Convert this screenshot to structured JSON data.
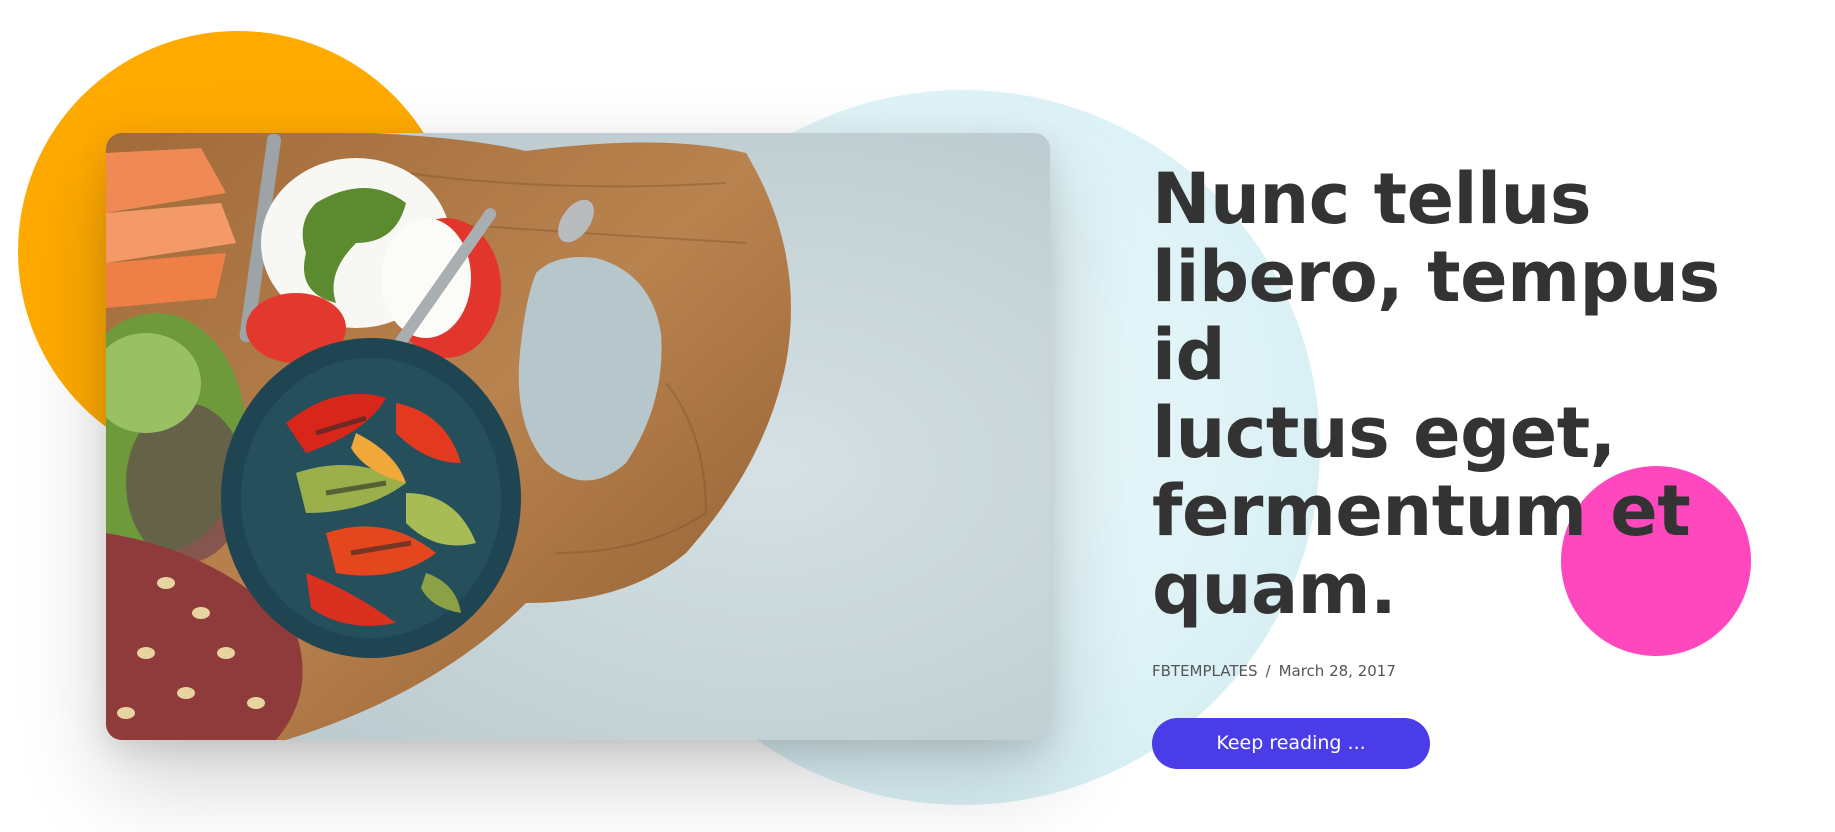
{
  "post": {
    "title": "Nunc tellus\nlibero, tempus id\nluctus eget,\nfermentum et\nquam.",
    "author": "FBTEMPLATES",
    "separator": "/",
    "date": "March 28, 2017",
    "cta_label": "Keep reading ..."
  },
  "colors": {
    "accent": "#4A3DE8",
    "blob_orange": "#FFAA00",
    "blob_pink": "#FF47BE",
    "blob_cyan": "#DFF3F7",
    "title_text": "#333333"
  },
  "image": {
    "icon": "food-photo-image"
  }
}
